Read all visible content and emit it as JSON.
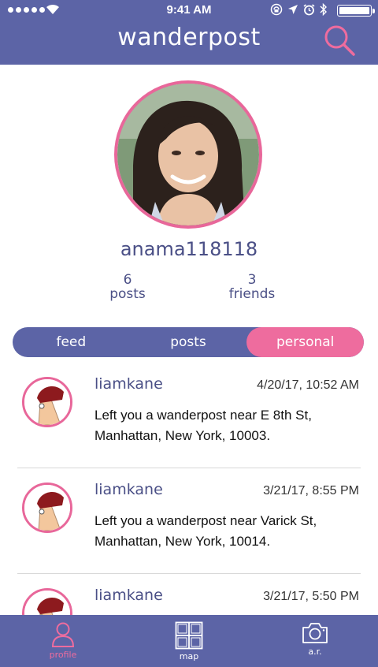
{
  "status_bar": {
    "time": "9:41 AM",
    "signal_icon": "signal-dots-icon",
    "wifi_icon": "wifi-icon",
    "status_icons": [
      "location-lock-icon",
      "location-arrow-icon",
      "alarm-icon",
      "bluetooth-icon"
    ],
    "battery_level": 1.0
  },
  "header": {
    "title": "wanderpost",
    "search_icon": "search-icon"
  },
  "profile": {
    "username": "anama118118",
    "posts_count": "6",
    "posts_label": "posts",
    "friends_count": "3",
    "friends_label": "friends"
  },
  "segments": [
    {
      "label": "feed",
      "active": false
    },
    {
      "label": "posts",
      "active": false
    },
    {
      "label": "personal",
      "active": true
    }
  ],
  "feed": [
    {
      "user": "liamkane",
      "time": "4/20/17, 10:52 AM",
      "text": "Left you a wanderpost near E 8th St, Manhattan, New York, 10003."
    },
    {
      "user": "liamkane",
      "time": "3/21/17, 8:55 PM",
      "text": "Left you a wanderpost near Varick St, Manhattan, New York, 10014."
    },
    {
      "user": "liamkane",
      "time": "3/21/17, 5:50 PM",
      "text": ""
    }
  ],
  "tabbar": [
    {
      "label": "profile",
      "icon": "person-icon",
      "active": true
    },
    {
      "label": "map",
      "icon": "map-icon",
      "active": false
    },
    {
      "label": "a.r.",
      "icon": "camera-icon",
      "active": false
    }
  ],
  "colors": {
    "primary": "#5c64a6",
    "accent": "#ee6c9e",
    "text": "#4a4f86"
  }
}
